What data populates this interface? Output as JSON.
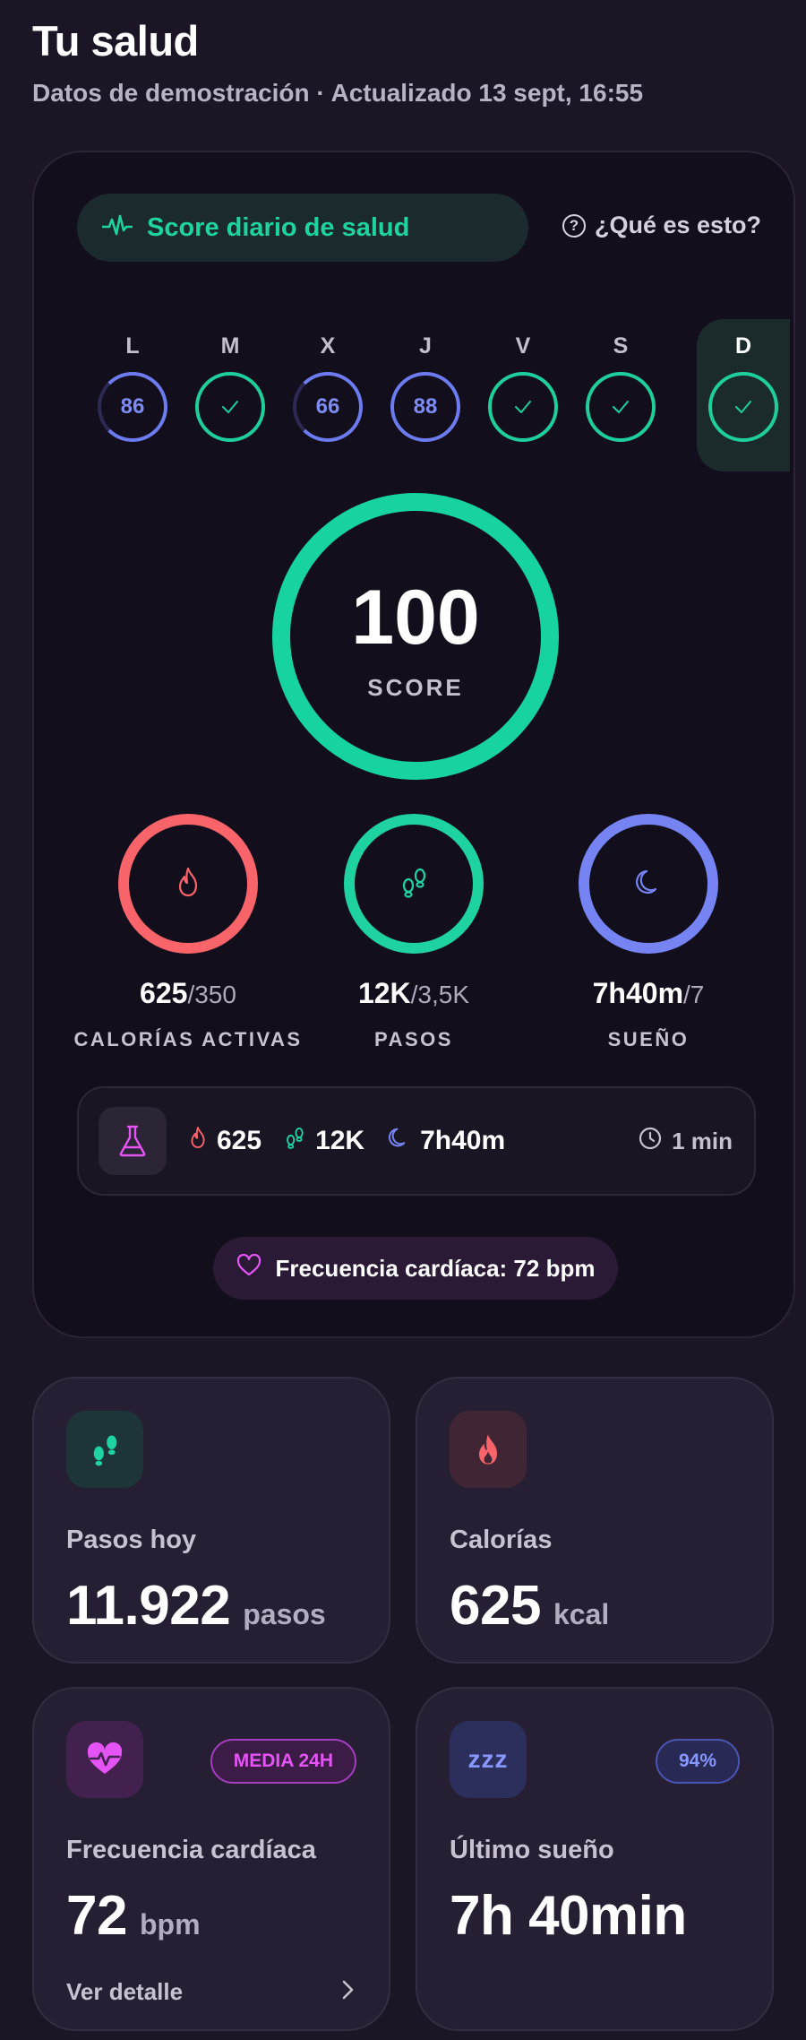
{
  "header": {
    "title": "Tu salud",
    "subtitle": "Datos de demostración · Actualizado 13 sept, 16:55"
  },
  "score_card": {
    "pill_label": "Score diario de salud",
    "help_label": "¿Qué es esto?",
    "help_glyph": "?",
    "week": [
      {
        "day": "L",
        "score": "86",
        "status": "score"
      },
      {
        "day": "M",
        "score": "",
        "status": "done"
      },
      {
        "day": "X",
        "score": "66",
        "status": "score"
      },
      {
        "day": "J",
        "score": "88",
        "status": "score"
      },
      {
        "day": "V",
        "score": "",
        "status": "done"
      },
      {
        "day": "S",
        "score": "",
        "status": "done"
      },
      {
        "day": "D",
        "score": "",
        "status": "done",
        "today": true
      }
    ],
    "score_value": "100",
    "score_label": "SCORE",
    "metrics": {
      "calories": {
        "value": "625",
        "goal": "/350",
        "label": "CALORÍAS ACTIVAS",
        "icon": "flame-icon"
      },
      "steps": {
        "value": "12K",
        "goal": "/3,5K",
        "label": "PASOS",
        "icon": "footprints-icon"
      },
      "sleep": {
        "value": "7h40m",
        "goal": "/7",
        "label": "SUEÑO",
        "icon": "moon-icon"
      }
    },
    "summary": {
      "calories": "625",
      "steps": "12K",
      "sleep": "7h40m",
      "time": "1 min"
    },
    "heart_pill": "Frecuencia cardíaca: 72 bpm"
  },
  "tiles": {
    "steps": {
      "label": "Pasos hoy",
      "value": "11.922",
      "unit": "pasos"
    },
    "calories": {
      "label": "Calorías",
      "value": "625",
      "unit": "kcal"
    },
    "heart": {
      "label": "Frecuencia cardíaca",
      "value": "72",
      "unit": "bpm",
      "badge": "MEDIA 24H",
      "link": "Ver detalle"
    },
    "sleep": {
      "label": "Último sueño",
      "value": "7h 40min",
      "badge": "94%",
      "icon_text": "zzz"
    }
  },
  "colors": {
    "background": "#1c1526",
    "accent_green": "#17d3a0",
    "calories_red": "#f8646a",
    "sleep_blue": "#7583f3",
    "heart_pink": "#e454f4"
  }
}
